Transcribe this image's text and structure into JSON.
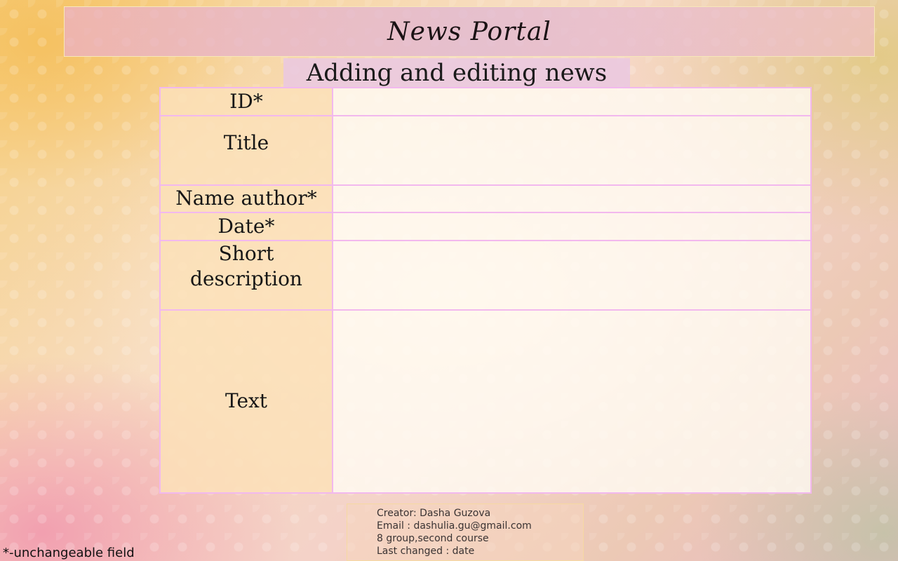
{
  "header": {
    "title": "News Portal"
  },
  "page": {
    "subtitle": "Adding and editing news"
  },
  "form": {
    "fields": [
      {
        "label": "ID*",
        "value": ""
      },
      {
        "label": "Title",
        "value": ""
      },
      {
        "label": "Name author*",
        "value": ""
      },
      {
        "label": "Date*",
        "value": ""
      },
      {
        "label": "Short description",
        "value": ""
      },
      {
        "label": "Text",
        "value": ""
      }
    ]
  },
  "footer": {
    "creator": "Creator: Dasha Guzova",
    "email": "Email : dashulia.gu@gmail.com",
    "group": "8 group,second course",
    "last_changed": "Last changed : date",
    "note": "*-unchangeable field"
  },
  "colors": {
    "border_accent": "#f2b8ee",
    "label_background": "#fce1b9",
    "header_background": "#e6b4cc"
  }
}
